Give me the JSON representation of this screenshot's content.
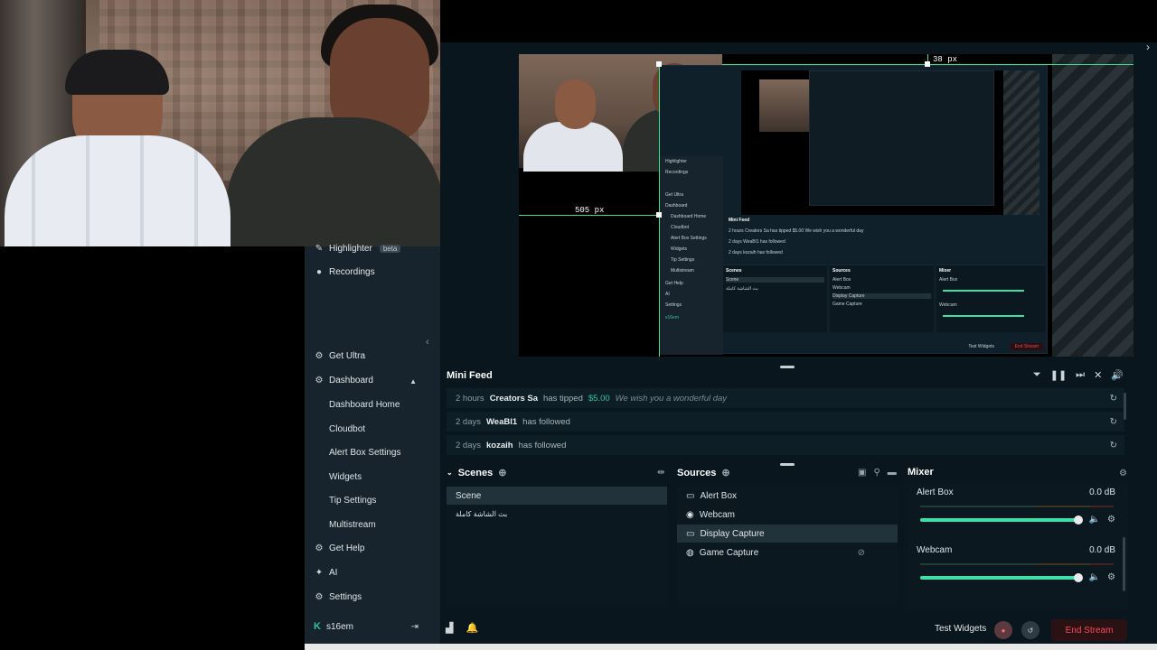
{
  "sidebar": {
    "items": [
      {
        "label": "Highlighter",
        "badge": "beta",
        "icon": "highlighter-icon"
      },
      {
        "label": "Recordings",
        "icon": "recordings-icon"
      },
      {
        "label": "Get Ultra",
        "icon": "ultra-icon"
      },
      {
        "label": "Dashboard",
        "icon": "dashboard-icon"
      },
      {
        "label": "Get Help",
        "icon": "help-icon"
      },
      {
        "label": "AI",
        "icon": "ai-sparkle-icon"
      },
      {
        "label": "Settings",
        "icon": "gear-icon"
      }
    ],
    "dashboard_sub": [
      "Dashboard Home",
      "Cloudbot",
      "Alert Box Settings",
      "Widgets",
      "Tip Settings",
      "Multistream"
    ],
    "user": "s16em"
  },
  "preview": {
    "measure_top": "38 px",
    "measure_left": "505 px"
  },
  "nested": {
    "side": [
      "Highlighter",
      "Recordings",
      "Get Ultra",
      "Dashboard",
      "Dashboard Home",
      "Cloudbot",
      "Alert Box Settings",
      "Widgets",
      "Tip Settings",
      "Multistream",
      "Get Help",
      "AI",
      "Settings",
      "s16em"
    ],
    "feed_title": "Mini Feed",
    "feed_rows": [
      "2 hours  Creators Sa  has tipped  $5.00  We wish you a wonderful day",
      "2 days  WeaBl1  has followed",
      "2 days  kozaih  has followed"
    ],
    "scenes": "Scenes",
    "sources": "Sources",
    "mixer": "Mixer",
    "scene_items": [
      "Scene",
      "بث الشاشة كاملة"
    ],
    "source_items": [
      "Alert Box",
      "Webcam",
      "Display Capture",
      "Game Capture"
    ],
    "mixer_items": [
      "Alert Box",
      "Webcam"
    ],
    "mixer_db": "0.0 dB",
    "test_widgets": "Test Widgets",
    "end_stream": "End Stream"
  },
  "feed": {
    "title": "Mini Feed",
    "rows": [
      {
        "time": "2 hours",
        "name": "Creators Sa",
        "action": "has tipped",
        "amount": "$5.00",
        "message": "We wish you a wonderful day"
      },
      {
        "time": "2 days",
        "name": "WeaBl1",
        "action": "has followed",
        "amount": "",
        "message": ""
      },
      {
        "time": "2 days",
        "name": "kozaih",
        "action": "has followed",
        "amount": "",
        "message": ""
      }
    ]
  },
  "scenes": {
    "title": "Scenes",
    "items": [
      "Scene",
      "بث الشاشة كاملة"
    ],
    "selected": "Scene"
  },
  "sources": {
    "title": "Sources",
    "items": [
      {
        "label": "Alert Box",
        "icon": "alert-box-icon"
      },
      {
        "label": "Webcam",
        "icon": "webcam-icon"
      },
      {
        "label": "Display Capture",
        "icon": "monitor-icon"
      },
      {
        "label": "Game Capture",
        "icon": "gamepad-icon"
      }
    ],
    "selected": "Display Capture"
  },
  "mixer": {
    "title": "Mixer",
    "channels": [
      {
        "label": "Alert Box",
        "db": "0.0 dB",
        "level": 0.98
      },
      {
        "label": "Webcam",
        "db": "0.0 dB",
        "level": 0.98
      }
    ]
  },
  "bottombar": {
    "test_widgets": "Test Widgets",
    "end_stream": "End Stream"
  },
  "colors": {
    "accent": "#31c3a2",
    "guide": "#3ee08a",
    "danger": "#ff4a5a",
    "panel": "#0b1820",
    "sidebar": "#17242d"
  }
}
